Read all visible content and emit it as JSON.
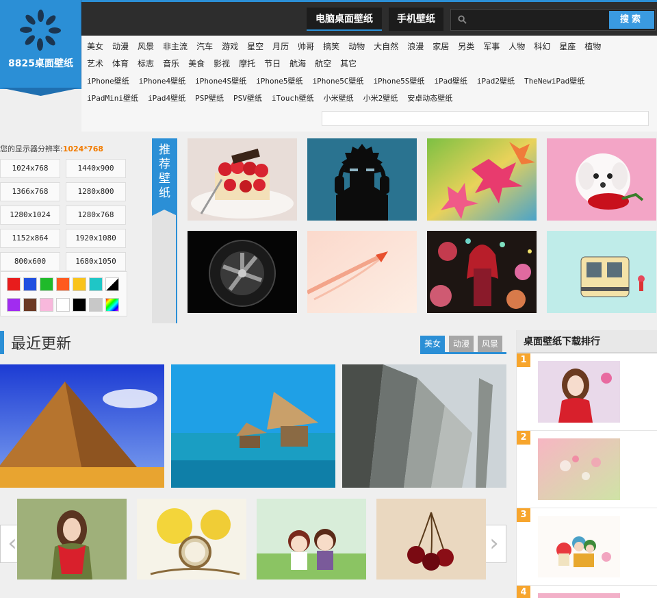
{
  "logo": {
    "text": "8825桌面壁纸"
  },
  "nav": {
    "tabs": [
      {
        "label": "电脑桌面壁纸",
        "active": true
      },
      {
        "label": "手机壁纸",
        "active": false
      }
    ],
    "search": {
      "value": "",
      "button": "搜索"
    }
  },
  "categories": {
    "row1": [
      "美女",
      "动漫",
      "风景",
      "非主流",
      "汽车",
      "游戏",
      "星空",
      "月历",
      "帅哥",
      "搞笑",
      "动物",
      "大自然",
      "浪漫",
      "家居",
      "另类",
      "军事",
      "人物",
      "科幻",
      "星座",
      "植物"
    ],
    "row2": [
      "艺术",
      "体育",
      "标志",
      "音乐",
      "美食",
      "影视",
      "摩托",
      "节日",
      "航海",
      "航空",
      "其它"
    ],
    "devices1": [
      "iPhone壁纸",
      "iPhone4壁纸",
      "iPhone4S壁纸",
      "iPhone5壁纸",
      "iPhone5C壁纸",
      "iPhone5S壁纸",
      "iPad壁纸",
      "iPad2壁纸",
      "TheNewiPad壁纸"
    ],
    "devices2": [
      "iPadMini壁纸",
      "iPad4壁纸",
      "PSP壁纸",
      "PSV壁纸",
      "iTouch壁纸",
      "小米壁纸",
      "小米2壁纸",
      "安卓动态壁纸"
    ]
  },
  "resolution": {
    "label": "您的显示器分辨率:",
    "current": "1024*768",
    "options": [
      "1024x768",
      "1440x900",
      "1366x768",
      "1280x800",
      "1280x1024",
      "1280x768",
      "1152x864",
      "1920x1080",
      "800x600",
      "1680x1050"
    ]
  },
  "colors": [
    "#e81c1c",
    "#1f4fe0",
    "#1fba2a",
    "#ff5a1f",
    "#f9c31b",
    "#1fc6c6",
    "black-white",
    "#a12cf0",
    "#6b3a25",
    "#f8b8dc",
    "#ffffff",
    "#000000",
    "#c8c8c8",
    "rainbow"
  ],
  "recommend": {
    "label": [
      "推",
      "荐",
      "壁",
      "纸"
    ],
    "thumbs": [
      "strawberry-cake",
      "headphone-silhouette",
      "autumn-leaves",
      "white-puppy",
      "car-wheel",
      "paper-plane",
      "anime-girl",
      "tram"
    ]
  },
  "latest": {
    "title": "最近更新",
    "tabs": [
      {
        "label": "美女",
        "active": true
      },
      {
        "label": "动漫",
        "active": false
      },
      {
        "label": "风景",
        "active": false
      }
    ],
    "large": [
      "pyramid",
      "beach-huts",
      "skyscrapers"
    ],
    "small": [
      "red-scarf-girl",
      "roses-pocket-watch",
      "cartoon-couple",
      "cherries"
    ]
  },
  "ranking": {
    "title": "桌面壁纸下载排行",
    "items": [
      {
        "rank": "1",
        "thumb": "christmas-girl"
      },
      {
        "rank": "2",
        "thumb": "pink-bokeh"
      },
      {
        "rank": "3",
        "thumb": "cartoon-kids"
      },
      {
        "rank": "4",
        "thumb": "pink"
      }
    ]
  },
  "arrows": {
    "prev": "‹",
    "next": "›"
  }
}
